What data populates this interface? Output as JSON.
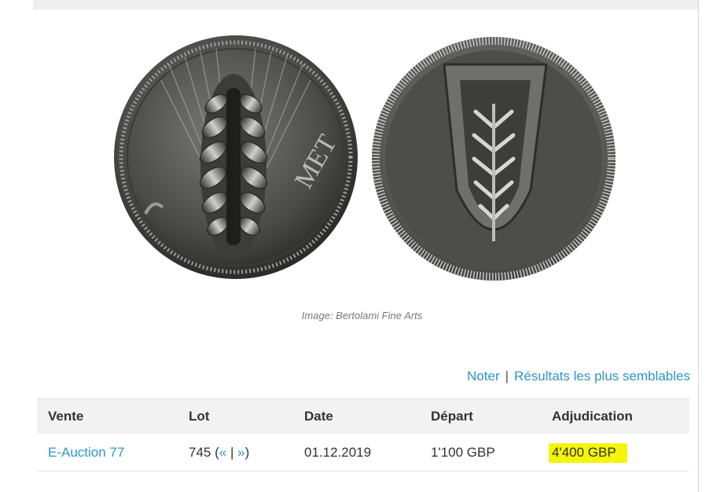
{
  "image": {
    "caption": "Image: Bertolami Fine Arts",
    "obverse_inscription": "MET"
  },
  "actions": {
    "rate": "Noter",
    "separator": "|",
    "similar": "Résultats les plus semblables"
  },
  "table": {
    "headers": [
      "Vente",
      "Lot",
      "Date",
      "Départ",
      "Adjudication"
    ],
    "row": {
      "sale": "E-Auction 77",
      "lot_number": "745",
      "lot_open": "(",
      "lot_prev": "«",
      "lot_sep": "|",
      "lot_next": "»",
      "lot_close": ")",
      "date": "01.12.2019",
      "start": "1'100 GBP",
      "hammer": "4'400 GBP"
    }
  },
  "colors": {
    "link": "#2e95c8",
    "highlight": "#f5f50a",
    "header_bg": "#f2f2f2"
  }
}
